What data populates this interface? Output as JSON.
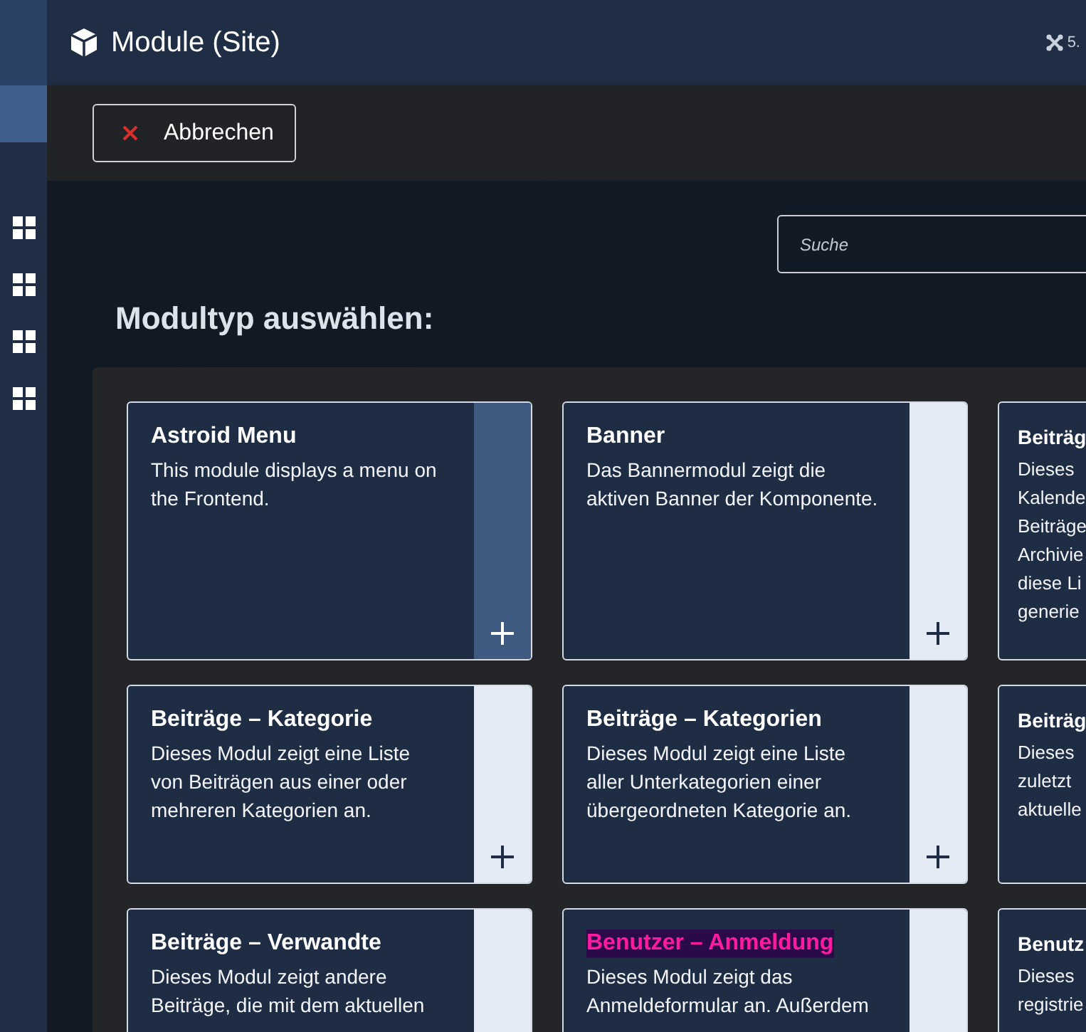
{
  "sidebar": {
    "items": [
      {
        "kind": "blank",
        "selected": true
      },
      {
        "kind": "grid",
        "selected": false
      },
      {
        "kind": "grid",
        "selected": false
      },
      {
        "kind": "grid",
        "selected": false
      },
      {
        "kind": "grid",
        "selected": false
      }
    ]
  },
  "header": {
    "title": "Module (Site)",
    "version": "5."
  },
  "toolbar": {
    "buttons": [
      {
        "label": "Abbrechen"
      }
    ]
  },
  "search": {
    "placeholder": "Suche"
  },
  "heading": "Modultyp auswählen:",
  "modules": [
    {
      "kind": "full",
      "title": "Astroid Menu",
      "description": "This module displays a menu on the Frontend.",
      "selected": true,
      "highlighted": false
    },
    {
      "kind": "full",
      "title": "Banner",
      "description": "Das Bannermodul zeigt die aktiven Banner der Komponente.",
      "selected": false,
      "highlighted": false
    },
    {
      "kind": "cut",
      "title": "Beiträg",
      "lines": [
        "Dieses",
        "Kalende",
        "Beiträge",
        "Archivie",
        "diese Li",
        "generie"
      ],
      "highlighted": false
    },
    {
      "kind": "full",
      "title": "Beiträge – Kategorie",
      "description": "Dieses Modul zeigt eine Liste von Beiträgen aus einer oder mehreren Kategorien an.",
      "selected": false,
      "highlighted": false
    },
    {
      "kind": "full",
      "title": "Beiträge – Kategorien",
      "description": "Dieses Modul zeigt eine Liste aller Unterkategorien einer übergeordneten Kategorie an.",
      "selected": false,
      "highlighted": false
    },
    {
      "kind": "cut",
      "title": "Beiträg",
      "lines": [
        "Dieses",
        "zuletzt",
        "aktuelle"
      ],
      "highlighted": false
    },
    {
      "kind": "full",
      "title": "Beiträge – Verwandte",
      "description": "Dieses Modul zeigt andere Beiträge, die mit dem aktuellen",
      "selected": false,
      "highlighted": false
    },
    {
      "kind": "full",
      "title": "Benutzer – Anmeldung",
      "description": "Dieses Modul zeigt das Anmeldeformular an. Außerdem",
      "selected": false,
      "highlighted": true
    },
    {
      "kind": "cut",
      "title": "Benutz",
      "lines": [
        "Dieses",
        "registrie"
      ],
      "highlighted": false
    }
  ]
}
